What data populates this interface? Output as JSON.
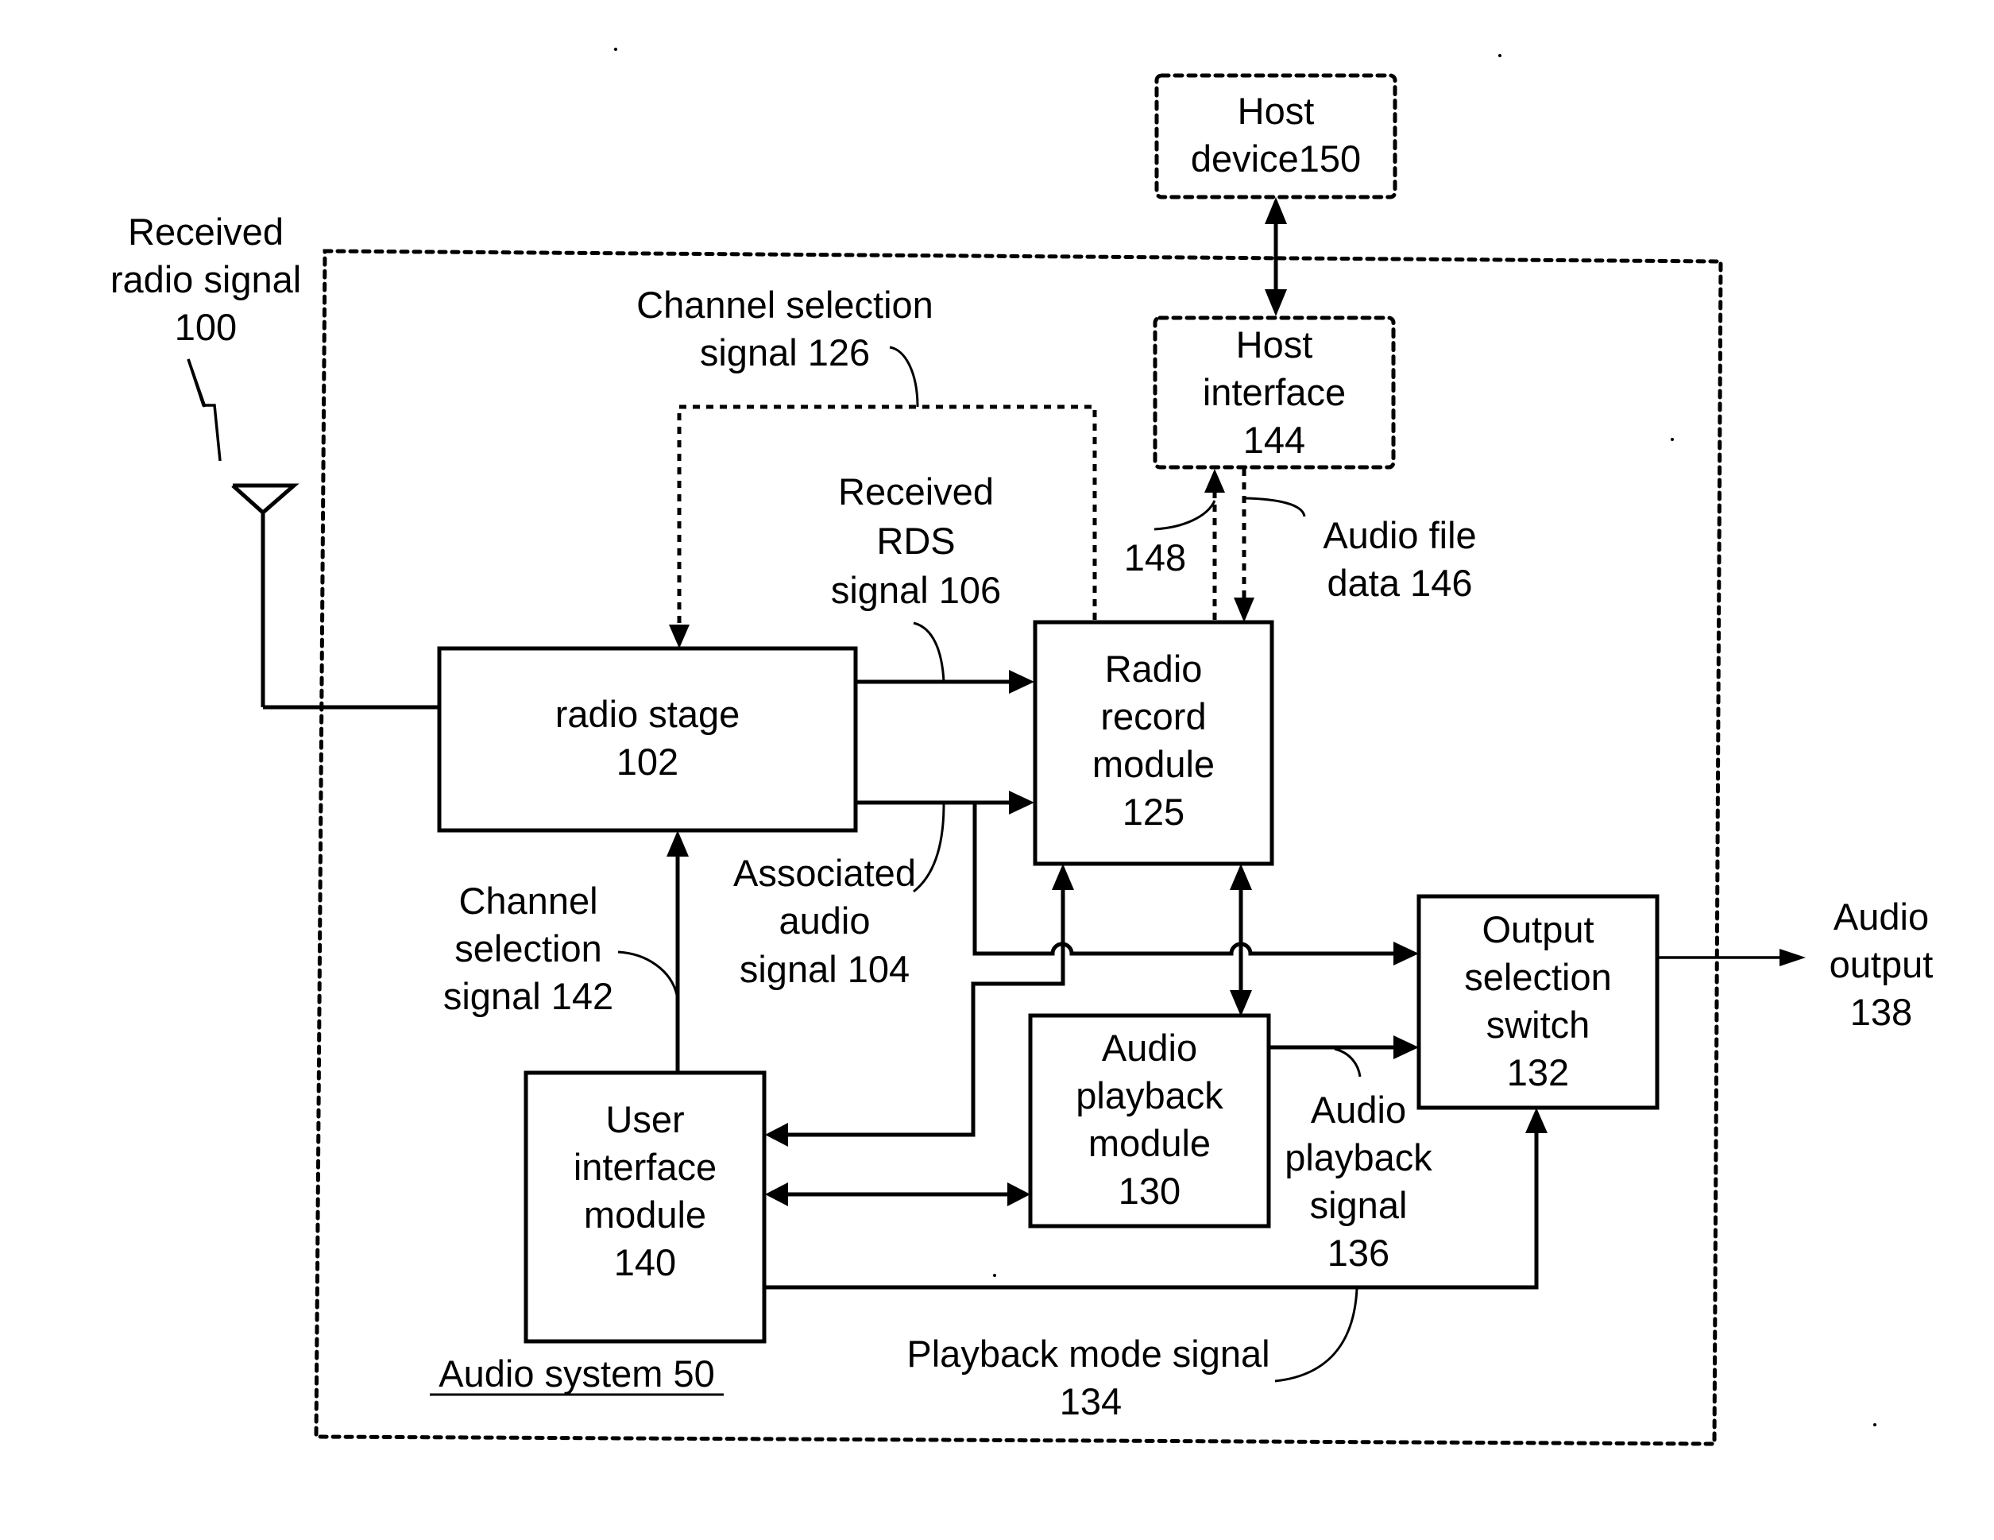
{
  "diagram": {
    "type": "block-diagram",
    "system_label": "Audio system 50",
    "blocks": {
      "host_device": {
        "lines": [
          "Host",
          "device150"
        ],
        "style": "dashed"
      },
      "host_interface": {
        "lines": [
          "Host",
          "interface",
          "144"
        ],
        "style": "dashed"
      },
      "radio_stage": {
        "lines": [
          "radio stage",
          "102"
        ],
        "style": "solid"
      },
      "radio_record": {
        "lines": [
          "Radio",
          "record",
          "module",
          "125"
        ],
        "style": "solid"
      },
      "output_switch": {
        "lines": [
          "Output",
          "selection",
          "switch",
          "132"
        ],
        "style": "solid"
      },
      "audio_playback": {
        "lines": [
          "Audio",
          "playback",
          "module",
          "130"
        ],
        "style": "solid"
      },
      "user_interface": {
        "lines": [
          "User",
          "interface",
          "module",
          "140"
        ],
        "style": "solid"
      }
    },
    "labels": {
      "received_radio": [
        "Received",
        "radio signal",
        "100"
      ],
      "channel_sel_126": [
        "Channel selection",
        "signal 126"
      ],
      "received_rds": [
        "Received",
        "RDS",
        "signal 106"
      ],
      "assoc_audio": [
        "Associated",
        "audio",
        "signal 104"
      ],
      "channel_sel_142": [
        "Channel",
        "selection",
        "signal 142"
      ],
      "label_148": "148",
      "audio_file": [
        "Audio file",
        "data 146"
      ],
      "playback_signal": [
        "Audio",
        "playback",
        "signal",
        "136"
      ],
      "playback_mode": [
        "Playback mode signal",
        "134"
      ],
      "audio_output": [
        "Audio",
        "output",
        "138"
      ]
    },
    "connections": [
      {
        "from": "antenna",
        "to": "radio_stage",
        "label": "Received radio signal 100"
      },
      {
        "from": "radio_stage",
        "to": "radio_record",
        "label": "Received RDS signal 106"
      },
      {
        "from": "radio_stage",
        "to": "radio_record",
        "label": "Associated audio signal 104"
      },
      {
        "from": "radio_stage",
        "to": "output_switch",
        "label": "Associated audio signal 104"
      },
      {
        "from": "radio_record",
        "to": "radio_stage",
        "label": "Channel selection signal 126",
        "style": "dashed"
      },
      {
        "from": "radio_record",
        "to": "host_interface",
        "label": "148",
        "style": "dashed"
      },
      {
        "from": "host_interface",
        "to": "radio_record",
        "label": "Audio file data 146",
        "style": "dashed"
      },
      {
        "from": "host_interface",
        "to": "host_device",
        "bidirectional": true
      },
      {
        "from": "radio_record",
        "to": "audio_playback",
        "bidirectional": true
      },
      {
        "from": "audio_playback",
        "to": "output_switch",
        "label": "Audio playback signal 136"
      },
      {
        "from": "user_interface",
        "to": "radio_stage",
        "label": "Channel selection signal 142"
      },
      {
        "from": "user_interface",
        "to": "radio_record",
        "bidirectional": true
      },
      {
        "from": "user_interface",
        "to": "audio_playback",
        "bidirectional": true
      },
      {
        "from": "user_interface",
        "to": "output_switch",
        "label": "Playback mode signal 134"
      },
      {
        "from": "output_switch",
        "to": "external",
        "label": "Audio output 138"
      }
    ]
  }
}
